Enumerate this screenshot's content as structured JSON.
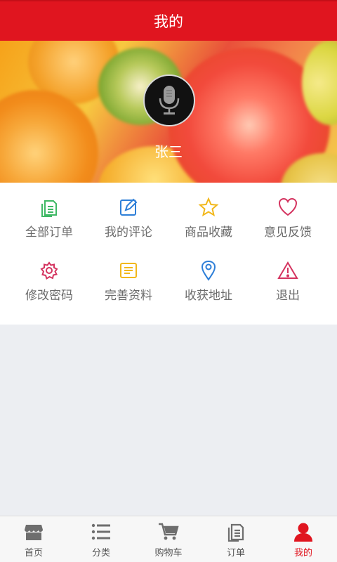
{
  "header": {
    "title": "我的"
  },
  "profile": {
    "username": "张三"
  },
  "menu": [
    {
      "label": "全部订单",
      "icon": "orders-icon",
      "color": "#3fb865"
    },
    {
      "label": "我的评论",
      "icon": "edit-icon",
      "color": "#2e7fd8"
    },
    {
      "label": "商品收藏",
      "icon": "star-icon",
      "color": "#f2b81c"
    },
    {
      "label": "意见反馈",
      "icon": "heart-icon",
      "color": "#d4335f"
    },
    {
      "label": "修改密码",
      "icon": "gear-icon",
      "color": "#d4335f"
    },
    {
      "label": "完善资料",
      "icon": "profile-doc-icon",
      "color": "#f2b81c"
    },
    {
      "label": "收获地址",
      "icon": "location-pin-icon",
      "color": "#2e7fd8"
    },
    {
      "label": "退出",
      "icon": "warning-icon",
      "color": "#d4335f"
    }
  ],
  "tabbar": {
    "active_color": "#e0151f",
    "items": [
      {
        "label": "首页",
        "icon": "store-icon"
      },
      {
        "label": "分类",
        "icon": "list-icon"
      },
      {
        "label": "购物车",
        "icon": "cart-icon"
      },
      {
        "label": "订单",
        "icon": "order-doc-icon"
      },
      {
        "label": "我的",
        "icon": "person-icon",
        "active": true
      }
    ]
  }
}
